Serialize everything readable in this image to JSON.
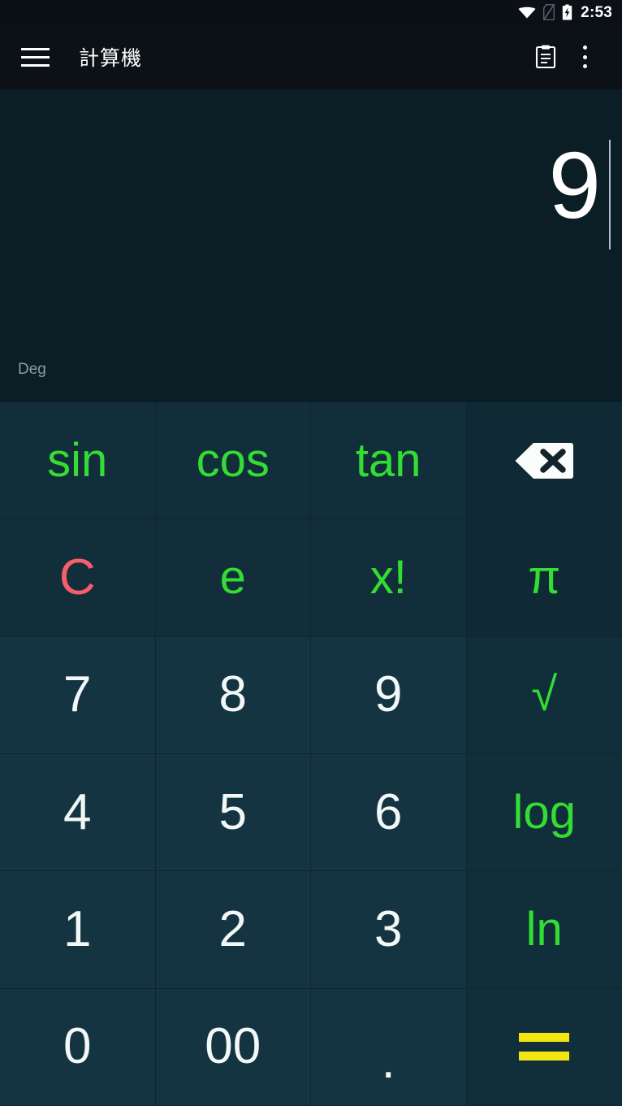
{
  "status_bar": {
    "time": "2:53",
    "icons": [
      "wifi-icon",
      "no-sim-icon",
      "battery-charging-icon"
    ]
  },
  "app_bar": {
    "menu_icon": "hamburger-menu-icon",
    "title": "計算機",
    "history_icon": "history-clipboard-icon",
    "overflow_icon": "more-vert-icon"
  },
  "display": {
    "expression": "9",
    "caret_visible": true,
    "angle_mode": "Deg"
  },
  "colors": {
    "status_bar_bg": "#0a1015",
    "app_bar_bg": "#0b1116",
    "display_bg": "#0b1e26",
    "key_bg": "#133440",
    "function_key_bg": "#122e3a",
    "operator_key_bg": "#112f3b",
    "divider": "#0e2630",
    "function_text": "#33dd33",
    "number_text": "#f2f7f8",
    "clear_text": "#f95c6a",
    "equals_text": "#f2e511",
    "mode_text": "#8a9ba3"
  },
  "keypad": {
    "rows": [
      [
        {
          "label": "sin",
          "name": "key-sin",
          "style": "fn",
          "col": 1
        },
        {
          "label": "cos",
          "name": "key-cos",
          "style": "fn",
          "col": 2
        },
        {
          "label": "tan",
          "name": "key-tan",
          "style": "fn",
          "col": 3
        },
        {
          "label": "",
          "name": "key-backspace",
          "style": "icon",
          "col": 4,
          "icon": "backspace-icon"
        }
      ],
      [
        {
          "label": "C",
          "name": "key-clear",
          "style": "clear",
          "col": 1
        },
        {
          "label": "e",
          "name": "key-e",
          "style": "fn",
          "col": 2
        },
        {
          "label": "x!",
          "name": "key-factorial",
          "style": "fn",
          "col": 3
        },
        {
          "label": "π",
          "name": "key-pi",
          "style": "fn",
          "col": 4
        }
      ],
      [
        {
          "label": "7",
          "name": "key-7",
          "style": "num",
          "col": 1
        },
        {
          "label": "8",
          "name": "key-8",
          "style": "num",
          "col": 2
        },
        {
          "label": "9",
          "name": "key-9",
          "style": "num",
          "col": 3
        },
        {
          "label": "√",
          "name": "key-sqrt",
          "style": "fn",
          "col": 4
        }
      ],
      [
        {
          "label": "4",
          "name": "key-4",
          "style": "num",
          "col": 1
        },
        {
          "label": "5",
          "name": "key-5",
          "style": "num",
          "col": 2
        },
        {
          "label": "6",
          "name": "key-6",
          "style": "num",
          "col": 3
        },
        {
          "label": "log",
          "name": "key-log",
          "style": "fn",
          "col": 4
        }
      ],
      [
        {
          "label": "1",
          "name": "key-1",
          "style": "num",
          "col": 1
        },
        {
          "label": "2",
          "name": "key-2",
          "style": "num",
          "col": 2
        },
        {
          "label": "3",
          "name": "key-3",
          "style": "num",
          "col": 3
        },
        {
          "label": "ln",
          "name": "key-ln",
          "style": "fn",
          "col": 4
        }
      ],
      [
        {
          "label": "0",
          "name": "key-0",
          "style": "num",
          "col": 1
        },
        {
          "label": "00",
          "name": "key-00",
          "style": "num",
          "col": 2
        },
        {
          "label": ".",
          "name": "key-decimal",
          "style": "dot",
          "col": 3
        },
        {
          "label": "=",
          "name": "key-equals",
          "style": "equals",
          "col": 4
        }
      ]
    ]
  }
}
